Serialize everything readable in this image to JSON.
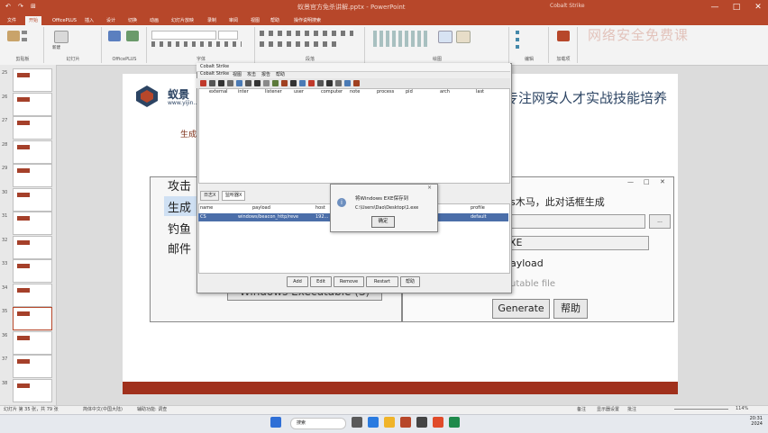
{
  "window": {
    "title": "蚁景官方免杀讲解.pptx - PowerPoint",
    "user": "Cobalt Strike",
    "quick_access": [
      "↶",
      "↷",
      "⊞"
    ],
    "controls": [
      "—",
      "□",
      "✕"
    ]
  },
  "ribbon": {
    "tabs": [
      "文件",
      "开始",
      "OfficePLUS",
      "插入",
      "设计",
      "切换",
      "动画",
      "幻灯片放映",
      "录制",
      "审阅",
      "视图",
      "帮助",
      "操作说明搜索"
    ],
    "active_tab": "开始",
    "groups": {
      "clipboard": "剪贴板",
      "slides_new": "新建",
      "slides_label": "幻灯片",
      "officeplus_label": "OfficePLUS",
      "font_label": "字体",
      "paragraph_label": "段落",
      "drawing_label": "绘图",
      "editing_label": "编辑",
      "addin_label": "加载项"
    },
    "watermark": "网络安全免费课"
  },
  "thumbnails": [
    {
      "num": "25",
      "selected": false
    },
    {
      "num": "26",
      "selected": false
    },
    {
      "num": "27",
      "selected": false
    },
    {
      "num": "28",
      "selected": false
    },
    {
      "num": "29",
      "selected": false
    },
    {
      "num": "30",
      "selected": false
    },
    {
      "num": "31",
      "selected": false
    },
    {
      "num": "32",
      "selected": false
    },
    {
      "num": "33",
      "selected": false
    },
    {
      "num": "34",
      "selected": false
    },
    {
      "num": "35",
      "selected": true
    },
    {
      "num": "36",
      "selected": false
    },
    {
      "num": "37",
      "selected": false
    },
    {
      "num": "38",
      "selected": false
    }
  ],
  "slide": {
    "brand": "蚁景",
    "url": "www.yijin...",
    "heading": "专注网安人才实战技能培养",
    "gen_label": "生成",
    "menu": [
      "攻击",
      "生成",
      "钓鱼",
      "邮件"
    ],
    "windows_exec_button": "Windows Executable (S)",
    "dialog_title": "s木马，此对话框生成",
    "exe_value": "XE",
    "payload_label": "ayload",
    "exec_label": "utable file",
    "generate_button": "Generate",
    "help_button": "帮助",
    "browse_button": "...",
    "win_controls": [
      "—",
      "□",
      "✕"
    ]
  },
  "cobalt": {
    "title": "Cobalt Strike",
    "menu": [
      "Cobalt Strike",
      "视图",
      "攻击",
      "报告",
      "帮助"
    ],
    "top_columns": [
      "external",
      "inter",
      "listener",
      "user",
      "computer",
      "note",
      "process",
      "pid",
      "arch",
      "last"
    ],
    "tabs": [
      "日志X",
      "监听器X"
    ],
    "bottom_columns": [
      "name",
      "payload",
      "host",
      "profile"
    ],
    "row": {
      "name": "CS",
      "payload": "windows/beacon_http/reve",
      "host": "192...",
      "profile": "default"
    },
    "buttons": [
      "Add",
      "Edit",
      "Remove",
      "Restart",
      "帮助"
    ]
  },
  "message": {
    "line1": "将Windows EXE保存到",
    "line2": "C:\\Users\\Dao\\Desktop\\1.exe",
    "ok": "确定",
    "close": "×"
  },
  "statusbar": {
    "slide_info": "幻灯片 第 35 张，共 79 张",
    "language": "简体中文(中国大陆)",
    "accessibility": "辅助功能: 调查",
    "notes": "备注",
    "display": "显示器设置",
    "comments": "批注",
    "zoom": "114%"
  },
  "taskbar": {
    "search": "搜索",
    "time": "20:31",
    "date": "2024"
  }
}
